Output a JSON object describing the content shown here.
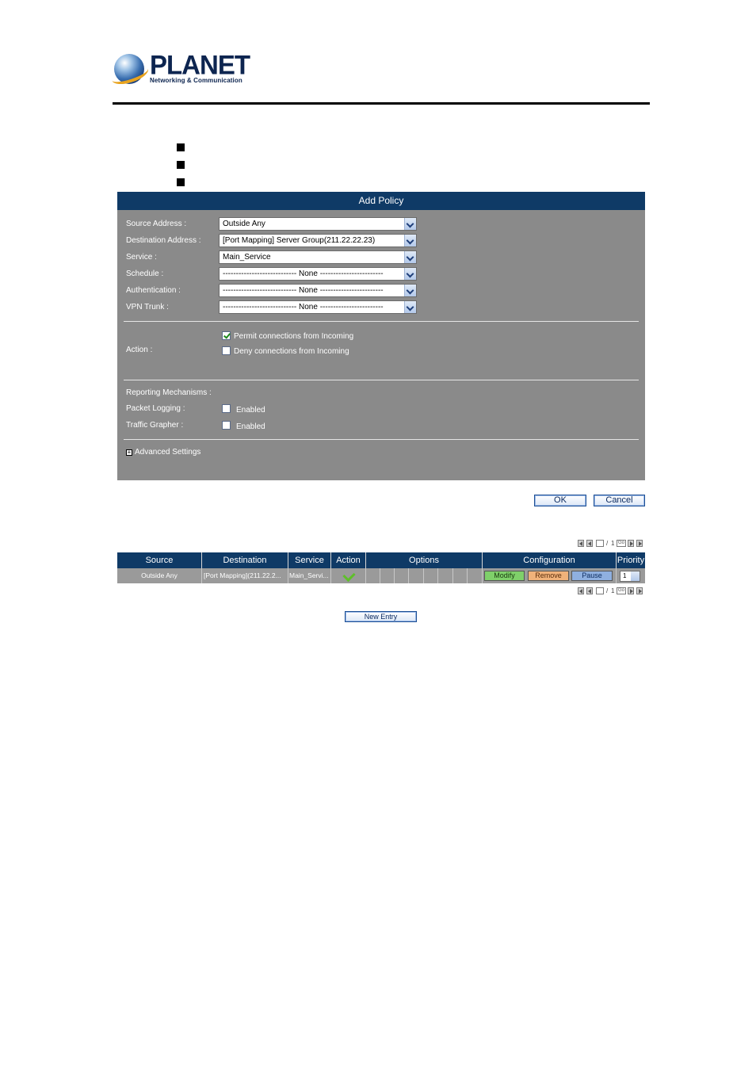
{
  "brand": {
    "name": "PLANET",
    "tagline": "Networking & Communication"
  },
  "add_policy": {
    "title": "Add Policy",
    "fields": [
      {
        "label": "Source Address :",
        "value": "Outside Any"
      },
      {
        "label": "Destination Address :",
        "value": "[Port Mapping] Server Group(211.22.22.23)"
      },
      {
        "label": "Service :",
        "value": "Main_Service"
      },
      {
        "label": "Schedule :",
        "value": "---------------------------- None ------------------------"
      },
      {
        "label": "Authentication :",
        "value": "---------------------------- None ------------------------"
      },
      {
        "label": "VPN Trunk :",
        "value": "---------------------------- None ------------------------"
      }
    ],
    "action": {
      "label": "Action :",
      "permit_label": "Permit connections from Incoming",
      "permit_checked": true,
      "deny_label": "Deny connections from Incoming",
      "deny_checked": false
    },
    "reporting": {
      "label": "Reporting Mechanisms :",
      "packet_logging_label": "Packet Logging :",
      "packet_logging_value": "Enabled",
      "traffic_grapher_label": "Traffic Grapher :",
      "traffic_grapher_value": "Enabled"
    },
    "advanced_label": "Advanced Settings",
    "ok_label": "OK",
    "cancel_label": "Cancel"
  },
  "pager": {
    "current": "1",
    "total": "1",
    "go_label": "Go"
  },
  "policy_table": {
    "headers": [
      "Source",
      "Destination",
      "Service",
      "Action",
      "Options",
      "Configuration",
      "Priority"
    ],
    "row": {
      "source": "Outside Any",
      "destination": "[Port Mapping](211.22.2...",
      "service": "Main_Servi...",
      "modify_label": "Modify",
      "remove_label": "Remove",
      "pause_label": "Pause",
      "priority": "1"
    }
  },
  "new_entry_label": "New Entry"
}
